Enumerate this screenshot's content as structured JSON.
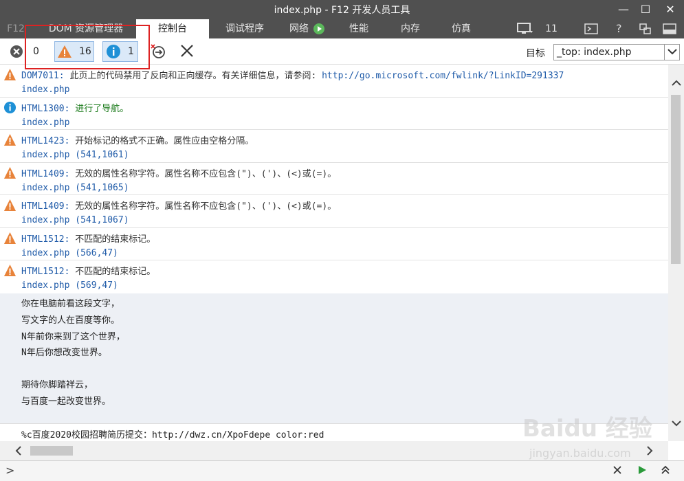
{
  "window": {
    "title": "index.php - F12 开发人员工具"
  },
  "tabs": [
    {
      "label": "F12"
    },
    {
      "label": "DOM 资源管理器"
    },
    {
      "label": "控制台"
    },
    {
      "label": "调试程序"
    },
    {
      "label": "网络"
    },
    {
      "label": "性能"
    },
    {
      "label": "内存"
    },
    {
      "label": "仿真"
    }
  ],
  "tabbar_right": {
    "device_count": "11"
  },
  "toolbar": {
    "errors_count": "0",
    "warnings_count": "16",
    "info_count": "1",
    "target_label": "目标",
    "target_value": "_top: index.php"
  },
  "entries": [
    {
      "type": "warning",
      "code": "DOM7011:",
      "message": "此页上的代码禁用了反向和正向缓存。有关详细信息，请参阅:",
      "link": "http://go.microsoft.com/fwlink/?LinkID=291337",
      "source": "index.php"
    },
    {
      "type": "info",
      "code": "HTML1300:",
      "message": "进行了导航。",
      "link": "",
      "source": "index.php"
    },
    {
      "type": "warning",
      "code": "HTML1423:",
      "message": "开始标记的格式不正确。属性应由空格分隔。",
      "link": "",
      "source": "index.php (541,1061)"
    },
    {
      "type": "warning",
      "code": "HTML1409:",
      "message": "无效的属性名称字符。属性名称不应包含(\")、(')、(<)或(=)。",
      "link": "",
      "source": "index.php (541,1065)"
    },
    {
      "type": "warning",
      "code": "HTML1409:",
      "message": "无效的属性名称字符。属性名称不应包含(\")、(')、(<)或(=)。",
      "link": "",
      "source": "index.php (541,1067)"
    },
    {
      "type": "warning",
      "code": "HTML1512:",
      "message": "不匹配的结束标记。",
      "link": "",
      "source": "index.php (566,47)"
    },
    {
      "type": "warning",
      "code": "HTML1512:",
      "message": "不匹配的结束标记。",
      "link": "",
      "source": "index.php (569,47)"
    }
  ],
  "log_lines": [
    "你在电脑前看这段文字，",
    "写文字的人在百度等你。",
    "N年前你来到了这个世界，",
    "N年后你想改变世界。",
    "",
    "期待你脚踏祥云，",
    "与百度一起改变世界。"
  ],
  "last_line": "%c百度2020校园招聘简历提交：http://dwz.cn/XpoFdepe color:red",
  "watermark": {
    "brand": "Baidu 经验",
    "url": "jingyan.baidu.com"
  },
  "input": {
    "prompt": ">"
  },
  "colors": {
    "warning": "#e8833a",
    "info": "#1e90d6",
    "error": "#555555",
    "accent": "#1e5aa8"
  }
}
